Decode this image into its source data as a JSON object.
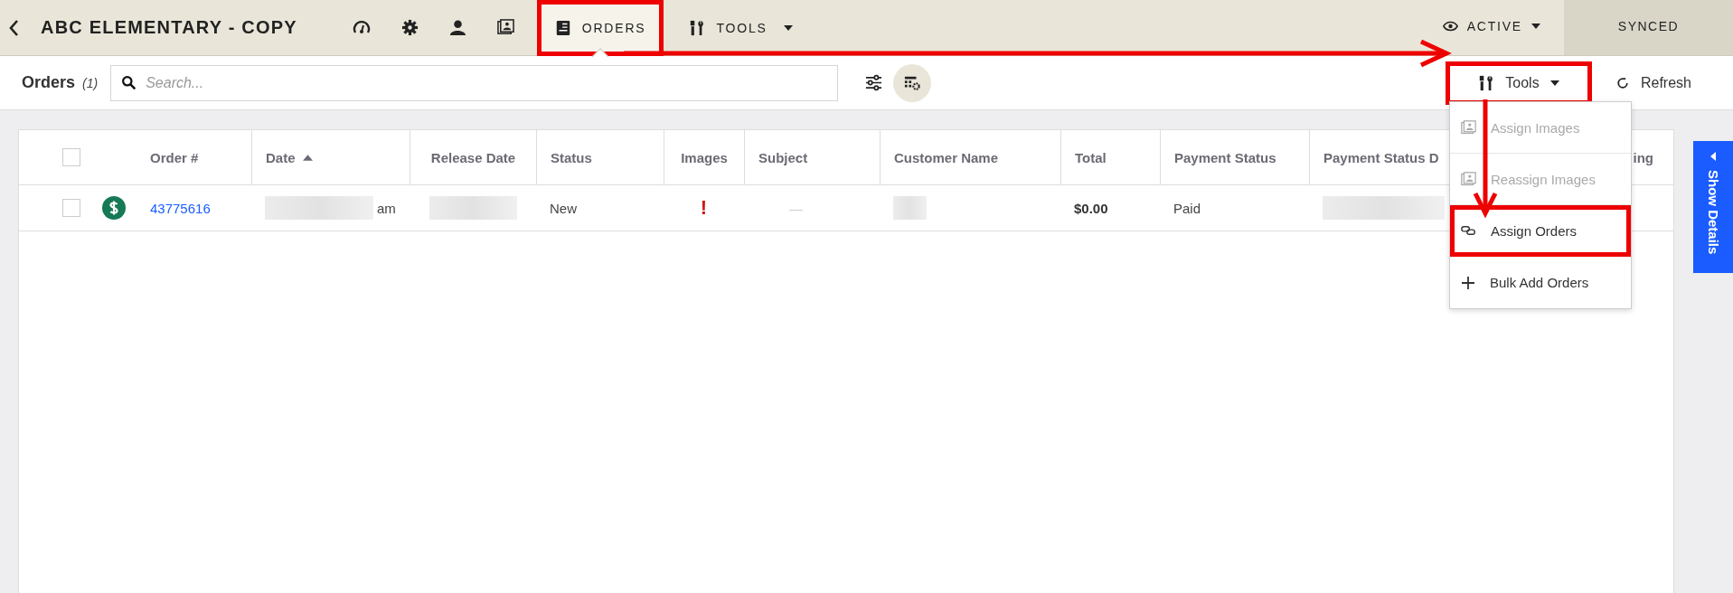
{
  "header": {
    "title": "ABC ELEMENTARY - COPY",
    "tabs": [
      {
        "label": "ORDERS",
        "selected": true,
        "highlighted": true,
        "kind": "tab"
      },
      {
        "label": "TOOLS",
        "selected": false,
        "highlighted": false,
        "kind": "dropdown"
      }
    ],
    "status": "ACTIVE",
    "sync": "SYNCED"
  },
  "toolbar": {
    "title": "Orders",
    "count": "(1)",
    "search": {
      "placeholder": "Search..."
    },
    "tools_button": {
      "label": "Tools",
      "highlighted": true
    },
    "refresh": "Refresh"
  },
  "tools_menu": [
    {
      "label": "Assign Images",
      "disabled": true,
      "highlighted": false
    },
    {
      "label": "Reassign Images",
      "disabled": true,
      "highlighted": false
    },
    {
      "label": "Assign Orders",
      "disabled": false,
      "highlighted": true
    },
    {
      "label": "Bulk Add Orders",
      "disabled": false,
      "highlighted": false
    }
  ],
  "table": {
    "select_all": {
      "checked": false
    },
    "columns": [
      {
        "label": "Order #",
        "sorted": false
      },
      {
        "label": "Date",
        "sorted": true
      },
      {
        "label": "Release Date",
        "sorted": false
      },
      {
        "label": "Status",
        "sorted": false
      },
      {
        "label": "Images",
        "sorted": false
      },
      {
        "label": "Subject",
        "sorted": false
      },
      {
        "label": "Customer Name",
        "sorted": false
      },
      {
        "label": "Total",
        "sorted": false
      },
      {
        "label": "Payment Status",
        "sorted": false
      },
      {
        "label": "Payment Status D",
        "sorted": false
      },
      {
        "label": "ing",
        "sorted": false
      }
    ],
    "rows": [
      {
        "selected": false,
        "cells": [
          {
            "kind": "link",
            "text": "43775616"
          },
          {
            "kind": "redacted",
            "text": "am"
          },
          {
            "kind": "redacted"
          },
          {
            "kind": "text",
            "text": "New"
          },
          {
            "kind": "alert",
            "text": "!"
          },
          {
            "kind": "muted",
            "text": "—"
          },
          {
            "kind": "redacted"
          },
          {
            "kind": "bold",
            "text": "$0.00"
          },
          {
            "kind": "text",
            "text": "Paid"
          },
          {
            "kind": "redacted"
          }
        ]
      }
    ]
  },
  "side_tab": {
    "label": "Show Details"
  }
}
